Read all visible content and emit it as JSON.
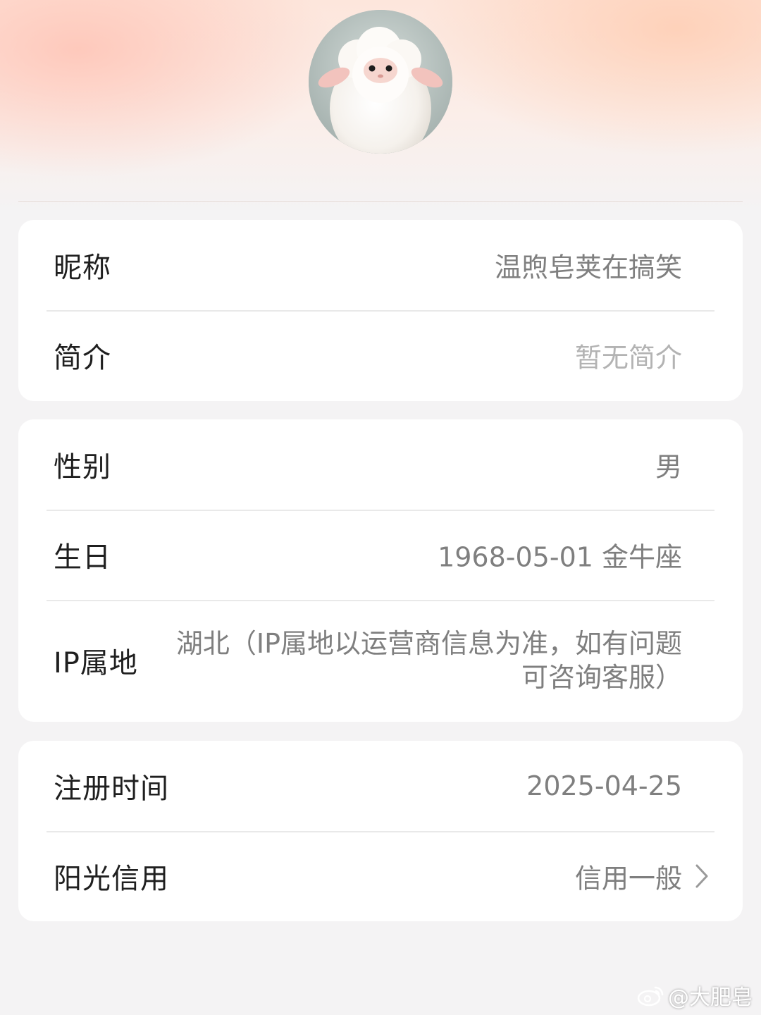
{
  "profile": {
    "avatar_icon": "sheep-avatar-icon"
  },
  "basic_info": {
    "nickname_label": "昵称",
    "nickname_value": "温煦皂荚在搞笑",
    "bio_label": "简介",
    "bio_value": "暂无简介"
  },
  "personal_info": {
    "gender_label": "性别",
    "gender_value": "男",
    "birthday_label": "生日",
    "birthday_value": "1968-05-01 金牛座",
    "ip_label": "IP属地",
    "ip_value": "湖北（IP属地以运营商信息为准，如有问题可咨询客服）"
  },
  "account_info": {
    "register_label": "注册时间",
    "register_value": "2025-04-25",
    "credit_label": "阳光信用",
    "credit_value": "信用一般",
    "credit_chevron_icon": "chevron-right-icon"
  },
  "watermark": {
    "logo_icon": "weibo-logo-icon",
    "text": "@大肥皂"
  },
  "colors": {
    "label": "#1f1f1f",
    "value": "#7f7f7f",
    "muted_value": "#b3b3b3",
    "card_bg": "#ffffff",
    "page_bg": "#f4f3f4"
  }
}
